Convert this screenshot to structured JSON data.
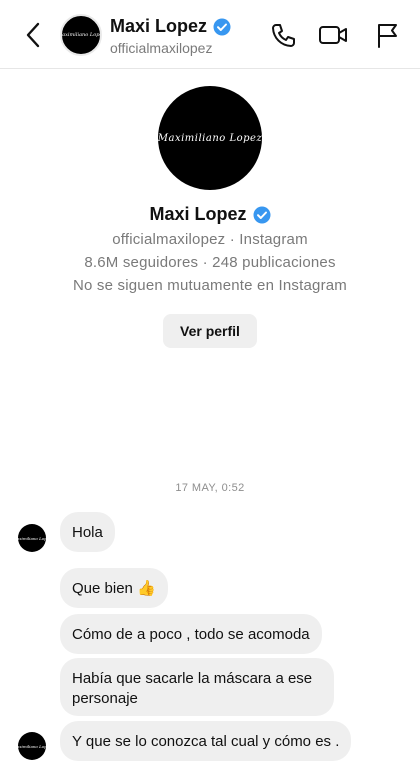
{
  "header": {
    "name": "Maxi Lopez",
    "username": "officialmaxilopez",
    "avatar_signature": "Maximiliano Lopez"
  },
  "profile": {
    "name": "Maxi Lopez",
    "handle_line": "officialmaxilopez · Instagram",
    "stats_line": "8.6M seguidores · 248 publicaciones",
    "mutual_line": "No se siguen mutuamente en Instagram",
    "view_profile_label": "Ver perfil"
  },
  "chat": {
    "timestamp": "17 MAY, 0:52",
    "messages": [
      {
        "text": "Hola"
      },
      {
        "text": "Que bien 👍"
      },
      {
        "text": "Cómo de a poco , todo se acomoda"
      },
      {
        "text": "Había que sacarle la máscara a ese personaje"
      },
      {
        "text": "Y que se lo conozca tal cual y cómo es ."
      }
    ]
  },
  "colors": {
    "verified_blue": "#3897f0",
    "bubble_gray": "#efefef",
    "secondary_text": "#7a7a7a"
  }
}
